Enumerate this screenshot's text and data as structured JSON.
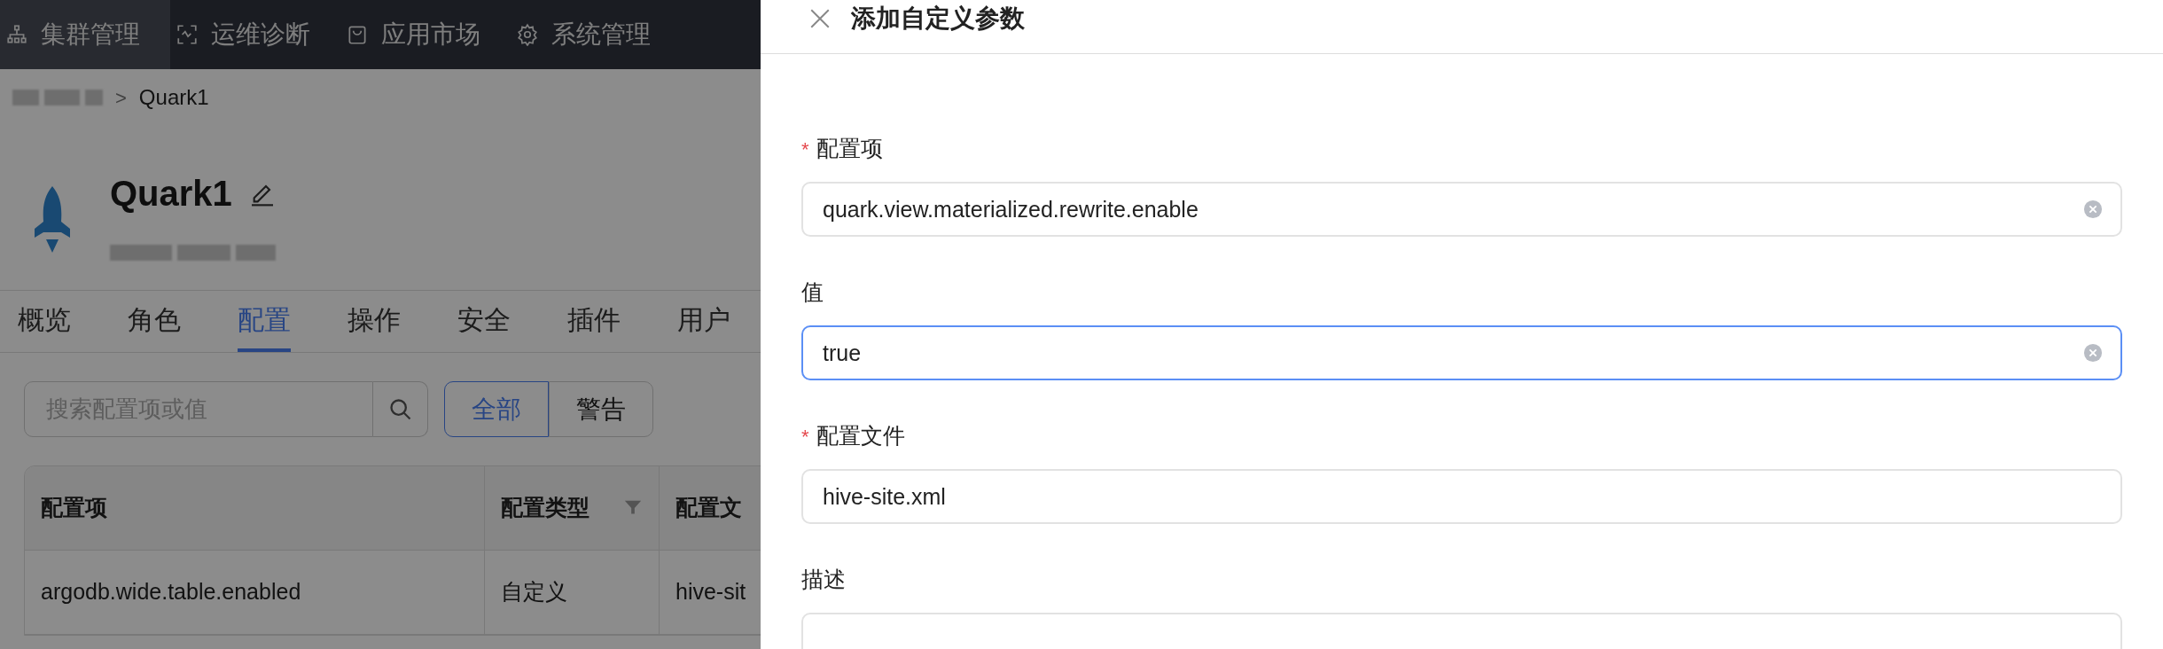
{
  "nav": {
    "items": [
      {
        "label": "集群管理",
        "selected": true
      },
      {
        "label": "运维诊断",
        "selected": false
      },
      {
        "label": "应用市场",
        "selected": false
      },
      {
        "label": "系统管理",
        "selected": false
      }
    ]
  },
  "breadcrumb": {
    "separator": ">",
    "current": "Quark1"
  },
  "header": {
    "title": "Quark1"
  },
  "tabs": [
    {
      "label": "概览",
      "selected": false
    },
    {
      "label": "角色",
      "selected": false
    },
    {
      "label": "配置",
      "selected": true
    },
    {
      "label": "操作",
      "selected": false
    },
    {
      "label": "安全",
      "selected": false
    },
    {
      "label": "插件",
      "selected": false
    },
    {
      "label": "用户",
      "selected": false
    }
  ],
  "search": {
    "placeholder": "搜索配置项或值"
  },
  "filters": [
    {
      "label": "全部",
      "selected": true
    },
    {
      "label": "警告",
      "selected": false
    }
  ],
  "table": {
    "columns": [
      {
        "label": "配置项",
        "filterable": false
      },
      {
        "label": "配置类型",
        "filterable": true
      },
      {
        "label": "配置文"
      }
    ],
    "rows": [
      [
        "argodb.wide.table.enabled",
        "自定义",
        "hive-sit"
      ]
    ]
  },
  "drawer": {
    "title": "添加自定义参数",
    "fields": [
      {
        "label": "配置项",
        "required_mark": "*",
        "value": "quark.view.materialized.rewrite.enable",
        "clearable": true,
        "focused": false
      },
      {
        "label": "值",
        "value": "true",
        "clearable": true,
        "focused": true
      },
      {
        "label": "配置文件",
        "required_mark": "*",
        "value": "hive-site.xml",
        "clearable": false,
        "focused": false
      },
      {
        "label": "描述",
        "focused": false
      }
    ]
  }
}
